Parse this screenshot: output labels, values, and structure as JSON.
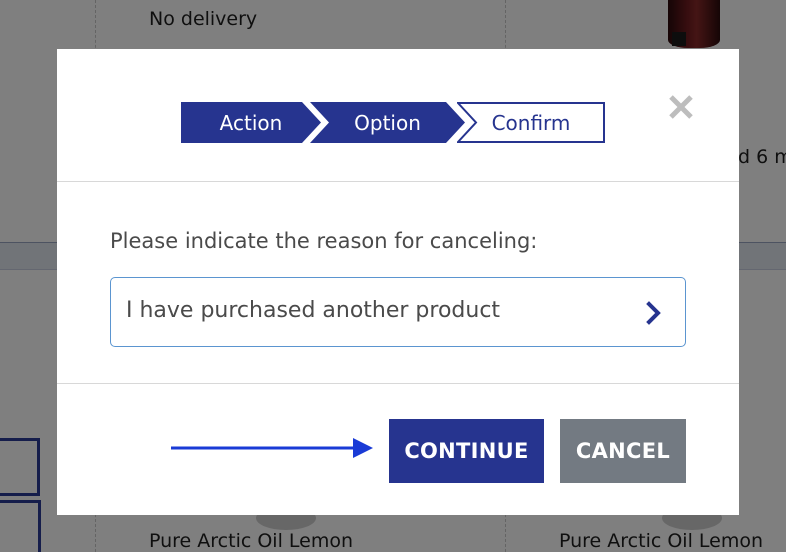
{
  "background": {
    "delivery_text": "No delivery",
    "partial_text": "d 6 m",
    "product_left": "Pure Arctic Oil Lemon",
    "product_right": "Pure Arctic Oil Lemon"
  },
  "modal": {
    "steps": [
      {
        "label": "Action",
        "state": "done"
      },
      {
        "label": "Option",
        "state": "active"
      },
      {
        "label": "Confirm",
        "state": "pending"
      }
    ],
    "close_icon": "close-icon",
    "prompt": "Please indicate the reason for canceling:",
    "reason_select": {
      "value": "I have purchased another product",
      "icon": "chevron-right-icon"
    },
    "continue_label": "CONTINUE",
    "cancel_label": "CANCEL"
  },
  "colors": {
    "primary": "#26348f",
    "select_border": "#5b95d0",
    "cancel_button": "#737a82",
    "arrow": "#1a3bd6",
    "close_icon": "#bdbdbd"
  }
}
